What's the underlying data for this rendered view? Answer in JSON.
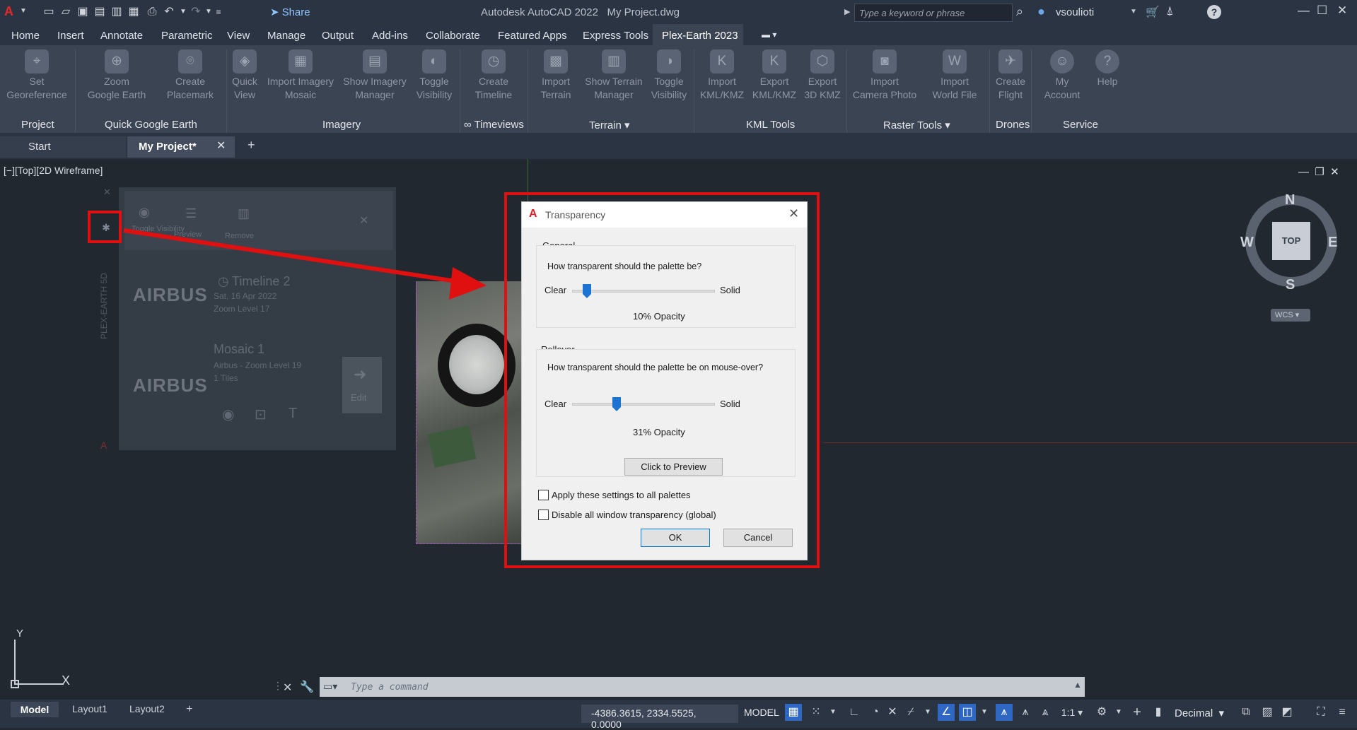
{
  "titlebar": {
    "share_label": "Share",
    "app_name": "Autodesk AutoCAD 2022",
    "file_name": "My Project.dwg",
    "search_placeholder": "Type a keyword or phrase",
    "user_name": "vsoulioti"
  },
  "menu": [
    "Home",
    "Insert",
    "Annotate",
    "Parametric",
    "View",
    "Manage",
    "Output",
    "Add-ins",
    "Collaborate",
    "Featured Apps",
    "Express Tools",
    "Plex-Earth 2023"
  ],
  "ribbon": {
    "buttons": [
      {
        "line1": "Set",
        "line2": "Georeference"
      },
      {
        "line1": "Zoom",
        "line2": "Google Earth"
      },
      {
        "line1": "Create",
        "line2": "Placemark"
      },
      {
        "line1": "Quick",
        "line2": "View"
      },
      {
        "line1": "Import Imagery",
        "line2": "Mosaic"
      },
      {
        "line1": "Show Imagery",
        "line2": "Manager"
      },
      {
        "line1": "Toggle",
        "line2": "Visibility"
      },
      {
        "line1": "Create",
        "line2": "Timeline"
      },
      {
        "line1": "Import",
        "line2": "Terrain"
      },
      {
        "line1": "Show Terrain",
        "line2": "Manager"
      },
      {
        "line1": "Toggle",
        "line2": "Visibility"
      },
      {
        "line1": "Import",
        "line2": "KML/KMZ"
      },
      {
        "line1": "Export",
        "line2": "KML/KMZ"
      },
      {
        "line1": "Export",
        "line2": "3D KMZ"
      },
      {
        "line1": "Import",
        "line2": "Camera Photo"
      },
      {
        "line1": "Import",
        "line2": "World File"
      },
      {
        "line1": "Create",
        "line2": "Flight"
      },
      {
        "line1": "My",
        "line2": "Account"
      },
      {
        "line1": "Help",
        "line2": ""
      }
    ],
    "panels": [
      "Project",
      "Quick Google Earth",
      "Imagery",
      "∞ Timeviews",
      "Terrain ▾",
      "KML Tools",
      "Raster Tools ▾",
      "Drones",
      "Service"
    ]
  },
  "file_tabs": {
    "start": "Start",
    "active": "My Project*"
  },
  "viewport": {
    "label": "[−][Top][2D Wireframe]",
    "palette": {
      "toolbar": [
        "Toggle Visibility",
        "Preview",
        "Remove"
      ],
      "items": [
        {
          "logo": "AIRBUS",
          "title": "Timeline 2",
          "line1": "Sat, 16 Apr 2022",
          "line2": "Zoom Level 17"
        },
        {
          "logo": "AIRBUS",
          "title": "Mosaic 1",
          "line1": "Airbus - Zoom Level 19",
          "line2": "1 Tiles"
        }
      ],
      "edit_label": "Edit",
      "sidebar_label": "PLEX-EARTH 5D"
    },
    "viewcube": {
      "top": "TOP",
      "n": "N",
      "s": "S",
      "e": "E",
      "w": "W",
      "wcs": "WCS"
    },
    "ucs": {
      "x": "X",
      "y": "Y"
    }
  },
  "dialog": {
    "title": "Transparency",
    "general": {
      "title": "General",
      "question": "How transparent should the palette be?",
      "clear": "Clear",
      "solid": "Solid",
      "opacity_text": "10% Opacity",
      "opacity_value": 10
    },
    "rollover": {
      "title": "Rollover",
      "question": "How transparent should the palette be on mouse-over?",
      "clear": "Clear",
      "solid": "Solid",
      "opacity_text": "31% Opacity",
      "opacity_value": 31,
      "preview_button": "Click to Preview"
    },
    "checkbox_all": "Apply these settings to all palettes",
    "checkbox_global": "Disable all window transparency (global)",
    "ok": "OK",
    "cancel": "Cancel"
  },
  "command": {
    "placeholder": "Type a command"
  },
  "status": {
    "layout_tabs": [
      "Model",
      "Layout1",
      "Layout2"
    ],
    "coords": "-4386.3615, 2334.5525, 0.0000",
    "model": "MODEL",
    "scale": "1:1",
    "units": "Decimal"
  },
  "colors": {
    "accent": "#1d73d1",
    "highlight": "#e01010",
    "ribbon_bg": "#3b4453",
    "viewport_bg": "#212830"
  }
}
